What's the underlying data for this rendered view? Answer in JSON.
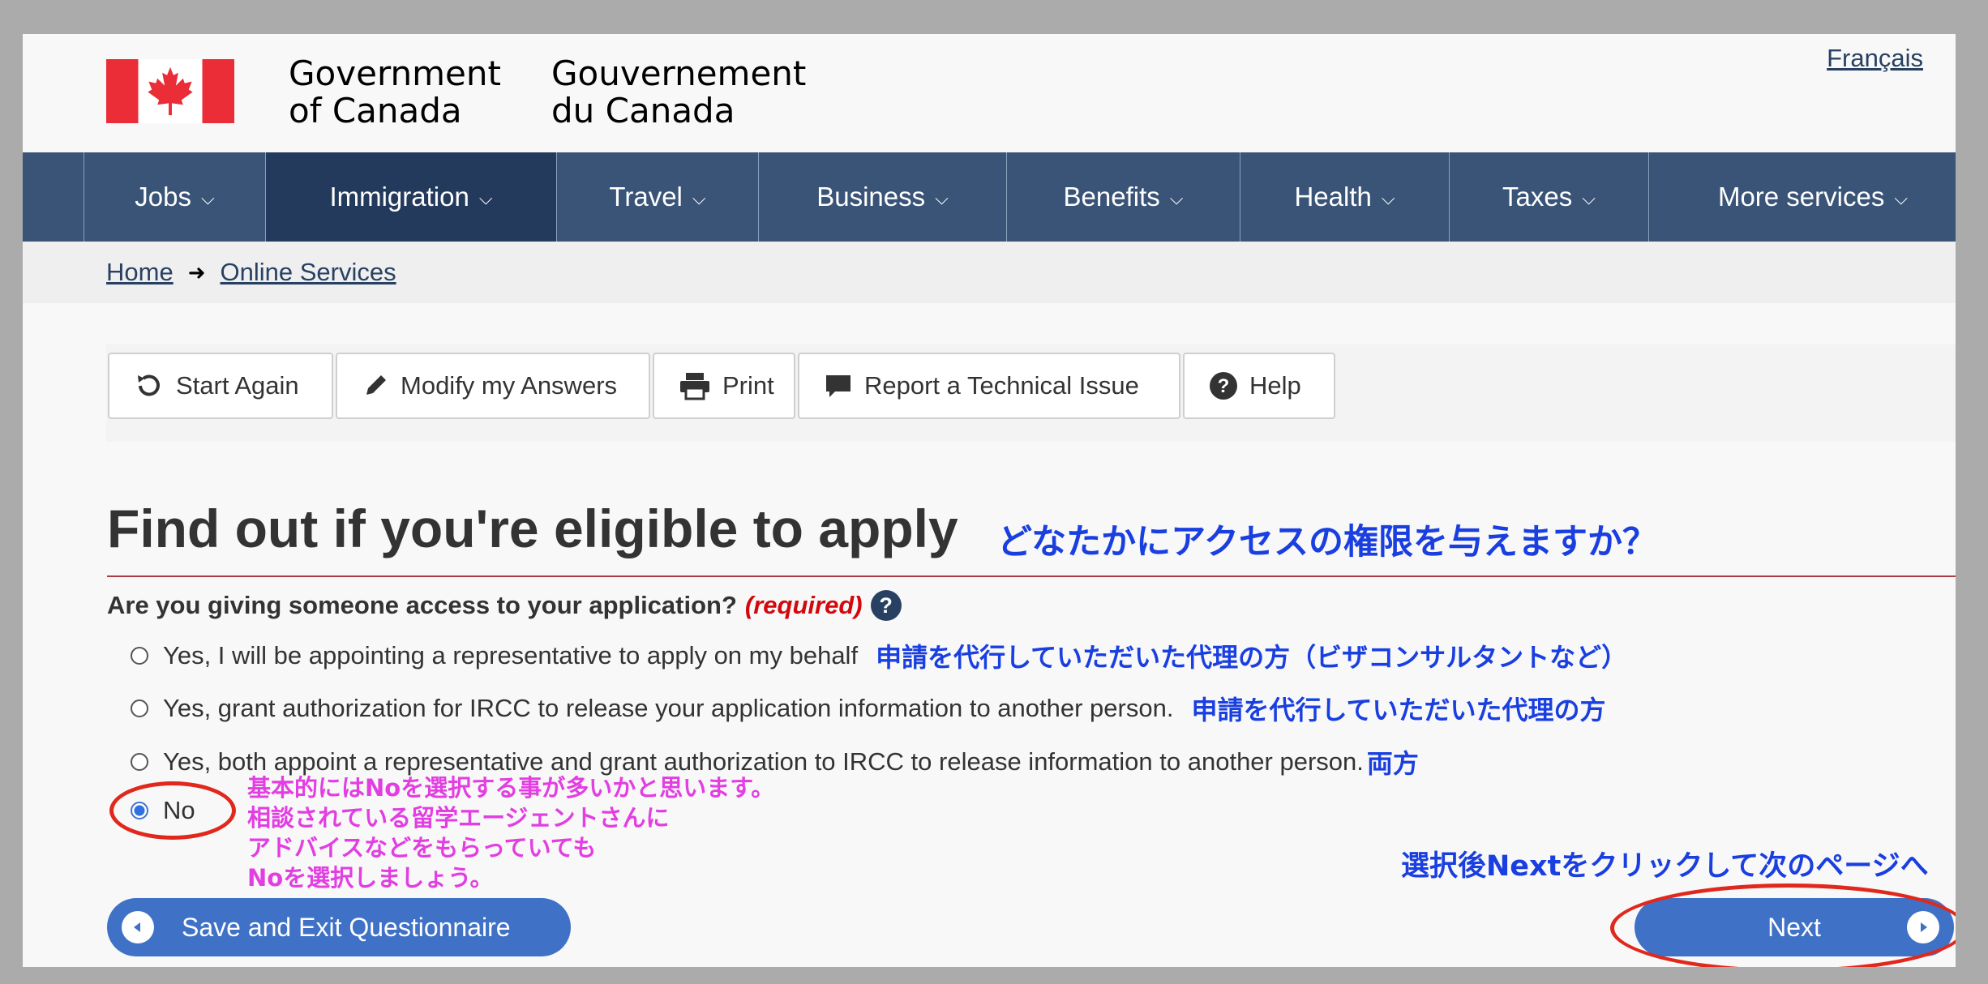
{
  "header": {
    "language_link": "Français",
    "signature_en_line1": "Government",
    "signature_en_line2": "of Canada",
    "signature_fr_line1": "Gouvernement",
    "signature_fr_line2": "du Canada",
    "colors": {
      "flag_red": "#eb2d37",
      "nav_bg": "#3a5478",
      "nav_active": "#243a5c"
    }
  },
  "nav": {
    "items": [
      {
        "label": "Jobs"
      },
      {
        "label": "Immigration",
        "active": true
      },
      {
        "label": "Travel"
      },
      {
        "label": "Business"
      },
      {
        "label": "Benefits"
      },
      {
        "label": "Health"
      },
      {
        "label": "Taxes"
      },
      {
        "label": "More services"
      }
    ]
  },
  "breadcrumb": {
    "items": [
      "Home",
      "Online Services"
    ]
  },
  "toolbar": {
    "start_again": "Start Again",
    "modify": "Modify my Answers",
    "print": "Print",
    "report": "Report a Technical Issue",
    "help": "Help"
  },
  "main": {
    "title": "Find out if you're eligible to apply",
    "title_annotation": "どなたかにアクセスの権限を与えますか？",
    "question": "Are you giving someone access to your application?",
    "required": "(required)",
    "help_glyph": "?",
    "options": [
      {
        "label": "Yes, I will be appointing a representative to apply on my behalf",
        "note": "申請を代行していただいた代理の方（ビザコンサルタントなど）",
        "checked": false
      },
      {
        "label": "Yes, grant authorization for IRCC to release your application information to another person.",
        "note": "申請を代行していただいた代理の方",
        "checked": false
      },
      {
        "label": "Yes, both appoint a representative and grant authorization to IRCC to release information to another person.",
        "note": "両方",
        "checked": false
      },
      {
        "label": "No",
        "note": "",
        "checked": true
      }
    ],
    "no_annotation": [
      "基本的にはNoを選択する事が多いかと思います。",
      "相談されている留学エージェントさんに",
      "アドバイスなどをもらっていても",
      "Noを選択しましょう。"
    ],
    "next_annotation": "選択後Nextをクリックして次のページへ"
  },
  "footer_buttons": {
    "save_exit": "Save and Exit Questionnaire",
    "next": "Next"
  }
}
